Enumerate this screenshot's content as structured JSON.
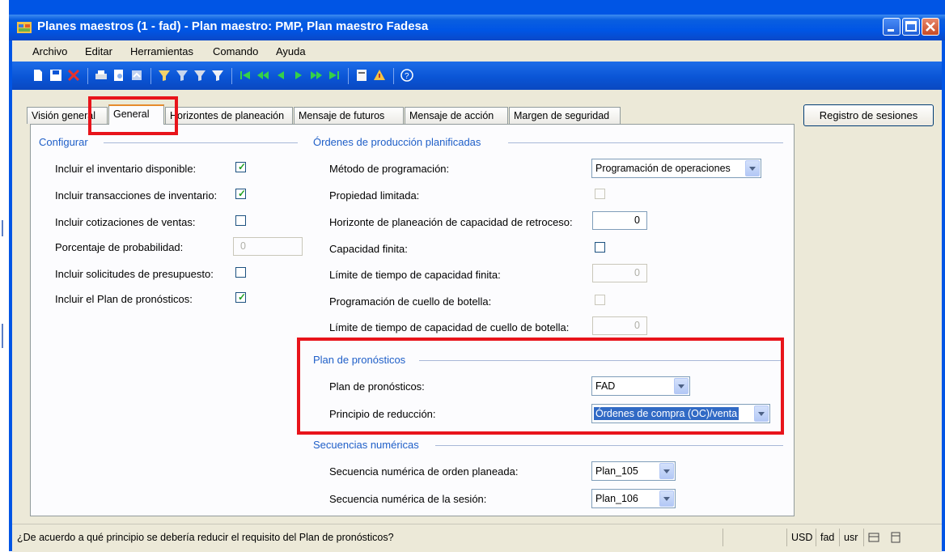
{
  "window": {
    "title": "Planes maestros (1 - fad) - Plan maestro: PMP, Plan maestro Fadesa"
  },
  "menu": [
    "Archivo",
    "Editar",
    "Herramientas",
    "Comando",
    "Ayuda"
  ],
  "toolbar_icons": [
    "new-icon",
    "save-icon",
    "delete-icon",
    "print-icon",
    "print-preview-icon",
    "export-icon",
    "filter-by-selection-icon",
    "filter-by-grid-icon",
    "advanced-filter-icon",
    "sort-icon",
    "first-record-icon",
    "previous-page-icon",
    "previous-record-icon",
    "next-record-icon",
    "next-page-icon",
    "last-record-icon",
    "document-handling-icon",
    "alert-icon",
    "help-icon"
  ],
  "tabs": [
    "Visión general",
    "General",
    "Horizontes de planeación",
    "Mensaje de futuros",
    "Mensaje de acción",
    "Margen de seguridad"
  ],
  "active_tab": "General",
  "side_button": "Registro de sesiones",
  "configurar": {
    "title": "Configurar",
    "fields": [
      {
        "label": "Incluir el inventario disponible:",
        "checked": true
      },
      {
        "label": "Incluir transacciones de inventario:",
        "checked": true
      },
      {
        "label": "Incluir cotizaciones de ventas:",
        "checked": false
      },
      {
        "label": "Porcentaje de probabilidad:",
        "value": "0"
      },
      {
        "label": "Incluir solicitudes de presupuesto:",
        "checked": false
      },
      {
        "label": "Incluir el Plan de pronósticos:",
        "checked": true
      }
    ]
  },
  "ordenes": {
    "title": "Órdenes de producción planificadas",
    "metodo_label": "Método de programación:",
    "metodo_value": "Programación de operaciones",
    "propiedad_label": "Propiedad limitada:",
    "horizonte_label": "Horizonte de planeación de capacidad de retroceso:",
    "horizonte_value": "0",
    "capacidad_label": "Capacidad finita:",
    "limite_label": "Límite de tiempo de capacidad finita:",
    "limite_value": "0",
    "cuello_label": "Programación de cuello de botella:",
    "limite_cuello_label": "Límite de tiempo de capacidad de cuello de botella:",
    "limite_cuello_value": "0"
  },
  "pronosticos": {
    "title": "Plan de pronósticos",
    "plan_label": "Plan de pronósticos:",
    "plan_value": "FAD",
    "principio_label": "Principio de reducción:",
    "principio_value": "Órdenes de compra (OC)/venta"
  },
  "secuencias": {
    "title": "Secuencias numéricas",
    "orden_label": "Secuencia numérica de orden planeada:",
    "orden_value": "Plan_105",
    "sesion_label": "Secuencia numérica de la sesión:",
    "sesion_value": "Plan_106"
  },
  "status": {
    "text": "¿De acuerdo a qué principio se debería reducir el requisito del Plan de pronósticos?",
    "currency": "USD",
    "company": "fad",
    "layer": "usr"
  }
}
